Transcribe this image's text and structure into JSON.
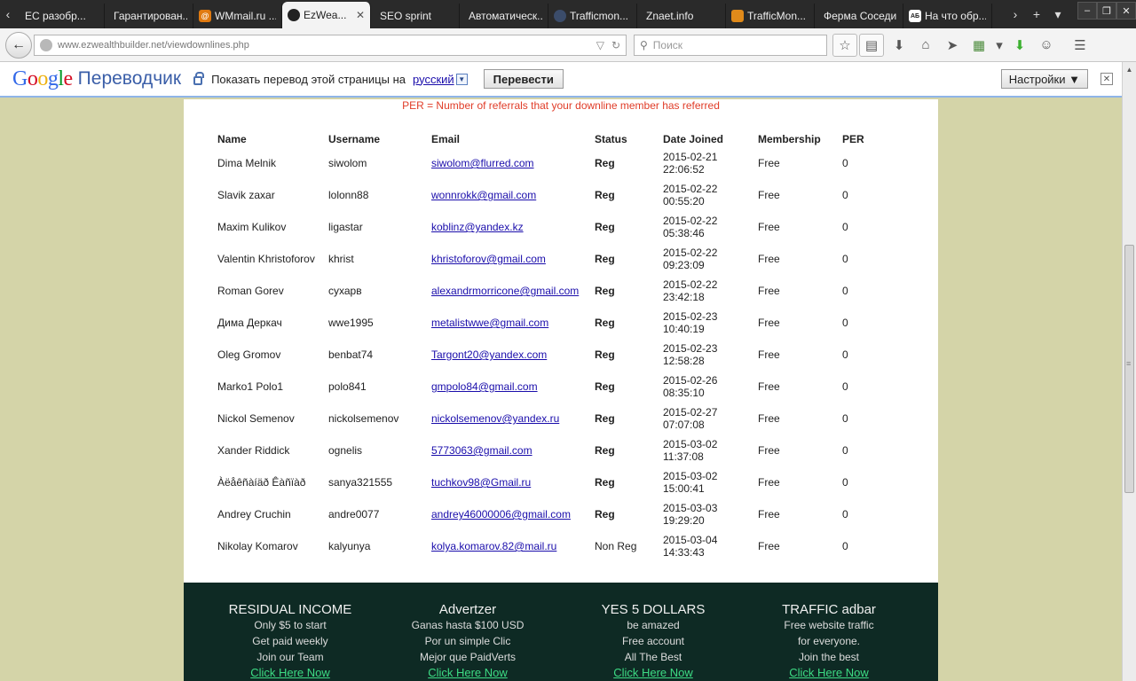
{
  "browser": {
    "tabs": [
      {
        "title": "EC разобр...",
        "favicon": "document-icon",
        "color": "#f0f0f0"
      },
      {
        "title": "Гарантирован...",
        "favicon": "document-icon",
        "color": "#f0f0f0"
      },
      {
        "title": "WMmail.ru ...",
        "favicon": "at-icon",
        "color": "#e07a10"
      },
      {
        "title": "EzWea...",
        "favicon": "swirl-icon",
        "color": "#222222",
        "active": true
      },
      {
        "title": "SEO sprint",
        "favicon": "document-icon",
        "color": "#f0f0f0"
      },
      {
        "title": "Автоматическ...",
        "favicon": "document-icon",
        "color": "#f0f0f0"
      },
      {
        "title": "Trafficmon...",
        "favicon": "circle-icon",
        "color": "#3b4c6a"
      },
      {
        "title": "Znaet.info",
        "favicon": "document-icon",
        "color": "#f0f0f0"
      },
      {
        "title": "TrafficMon...",
        "favicon": "cart-icon",
        "color": "#e08a1a"
      },
      {
        "title": "Ферма Соседи I",
        "favicon": "document-icon",
        "color": "#f0f0f0"
      },
      {
        "title": "На что обр...",
        "favicon": "ab-icon",
        "color": "#ffffff"
      }
    ],
    "url_domain": "www.ezwealthbuilder.net",
    "url_path": "/viewdownlines.php",
    "search_placeholder": "Поиск"
  },
  "translate": {
    "logo_word": "Google",
    "product": "Переводчик",
    "prompt": "Показать перевод этой страницы на",
    "language": "русский",
    "translate_button": "Перевести",
    "settings_button": "Настройки ▼",
    "close": "✕"
  },
  "page": {
    "per_note": "PER = Number of referrals that your downline member has referred",
    "columns": [
      "Name",
      "Username",
      "Email",
      "Status",
      "Date Joined",
      "Membership",
      "PER"
    ],
    "rows": [
      {
        "name": "Dima Melnik",
        "username": "siwolom",
        "email": "siwolom@flurred.com",
        "status": "Reg",
        "date": "2015-02-21",
        "time": "22:06:52",
        "membership": "Free",
        "per": "0"
      },
      {
        "name": "Slavik zaxar",
        "username": "lolonn88",
        "email": "wonnrokk@gmail.com",
        "status": "Reg",
        "date": "2015-02-22",
        "time": "00:55:20",
        "membership": "Free",
        "per": "0"
      },
      {
        "name": "Maxim Kulikov",
        "username": "ligastar",
        "email": "koblinz@yandex.kz",
        "status": "Reg",
        "date": "2015-02-22",
        "time": "05:38:46",
        "membership": "Free",
        "per": "0"
      },
      {
        "name": "Valentin Khristoforov",
        "username": "khrist",
        "email": "khristoforov@gmail.com",
        "status": "Reg",
        "date": "2015-02-22",
        "time": "09:23:09",
        "membership": "Free",
        "per": "0"
      },
      {
        "name": "Roman Gorev",
        "username": "сухарв",
        "email": "alexandrmorricone@gmail.com",
        "status": "Reg",
        "date": "2015-02-22",
        "time": "23:42:18",
        "membership": "Free",
        "per": "0"
      },
      {
        "name": "Дима Деркач",
        "username": "wwe1995",
        "email": "metalistwwe@gmail.com",
        "status": "Reg",
        "date": "2015-02-23",
        "time": "10:40:19",
        "membership": "Free",
        "per": "0"
      },
      {
        "name": "Oleg Gromov",
        "username": "benbat74",
        "email": "Targont20@yandex.com",
        "status": "Reg",
        "date": "2015-02-23",
        "time": "12:58:28",
        "membership": "Free",
        "per": "0"
      },
      {
        "name": "Marko1 Polo1",
        "username": "polo841",
        "email": "gmpolo84@gmail.com",
        "status": "Reg",
        "date": "2015-02-26",
        "time": "08:35:10",
        "membership": "Free",
        "per": "0"
      },
      {
        "name": "Nickol Semenov",
        "username": "nickolsemenov",
        "email": "nickolsemenov@yandex.ru",
        "status": "Reg",
        "date": "2015-02-27",
        "time": "07:07:08",
        "membership": "Free",
        "per": "0"
      },
      {
        "name": "Xander Riddick",
        "username": "ognelis",
        "email": "5773063@gmail.com",
        "status": "Reg",
        "date": "2015-03-02",
        "time": "11:37:08",
        "membership": "Free",
        "per": "0"
      },
      {
        "name": "Àëåêñàíäð Êàñïàð",
        "username": "sanya321555",
        "email": "tuchkov98@Gmail.ru",
        "status": "Reg",
        "date": "2015-03-02",
        "time": "15:00:41",
        "membership": "Free",
        "per": "0"
      },
      {
        "name": "Andrey Cruchin",
        "username": "andre0077",
        "email": "andrey46000006@gmail.com",
        "status": "Reg",
        "date": "2015-03-03",
        "time": "19:29:20",
        "membership": "Free",
        "per": "0"
      },
      {
        "name": "Nikolay Komarov",
        "username": "kalyunya",
        "email": "kolya.komarov.82@mail.ru",
        "status": "Non Reg",
        "date": "2015-03-04",
        "time": "14:33:43",
        "membership": "Free",
        "per": "0"
      }
    ],
    "footer": [
      {
        "title": "RESIDUAL INCOME",
        "lines": [
          "Only $5 to start",
          "Get paid weekly",
          "Join our Team"
        ],
        "cta": "Click Here Now"
      },
      {
        "title": "Advertzer",
        "lines": [
          "Ganas hasta $100 USD",
          "Por un simple Clic",
          "Mejor que PaidVerts"
        ],
        "cta": "Click Here Now"
      },
      {
        "title": "YES 5 DOLLARS",
        "lines": [
          "be amazed",
          "Free account",
          "All The Best"
        ],
        "cta": "Click Here Now"
      },
      {
        "title": "TRAFFIC adbar",
        "lines": [
          "Free website traffic",
          "for everyone.",
          "Join the best"
        ],
        "cta": "Click Here Now"
      }
    ]
  },
  "colors": {
    "page_bg": "#d4d4a8",
    "footer_bg": "#0e2a24",
    "note_red": "#e03c28",
    "link_blue": "#1a0dab",
    "cta_green": "#3ddc84"
  }
}
